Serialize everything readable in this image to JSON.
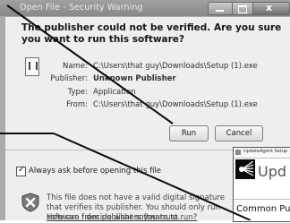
{
  "dialog": {
    "title": "Open File - Security Warning",
    "heading": "The publisher could not be verified.  Are you sure you want to run this software?",
    "info": {
      "name_label": "Name:",
      "name_value": "C:\\Users\\that guy\\Downloads\\Setup (1).exe",
      "publisher_label": "Publisher:",
      "publisher_value": "Unknown Publisher",
      "type_label": "Type:",
      "type_value": "Application",
      "from_label": "From:",
      "from_value": "C:\\Users\\that guy\\Downloads\\Setup (1).exe"
    },
    "buttons": {
      "run": "Run",
      "cancel": "Cancel"
    },
    "checkbox": {
      "label": "Always ask before opening this file",
      "checked": true
    },
    "warning_text": "This file does not have a valid digital signature that verifies its publisher.  You should only run software from publishers you trust.",
    "help_link": "How can I decide what software to run?"
  },
  "overlay": {
    "title": "UpdateAgent Setup",
    "brand": "Upd",
    "subtitle": "Common Pu"
  },
  "icons": {
    "file": "application-file-icon",
    "shield": "security-shield-icon",
    "logo": "starburst-logo-icon"
  }
}
